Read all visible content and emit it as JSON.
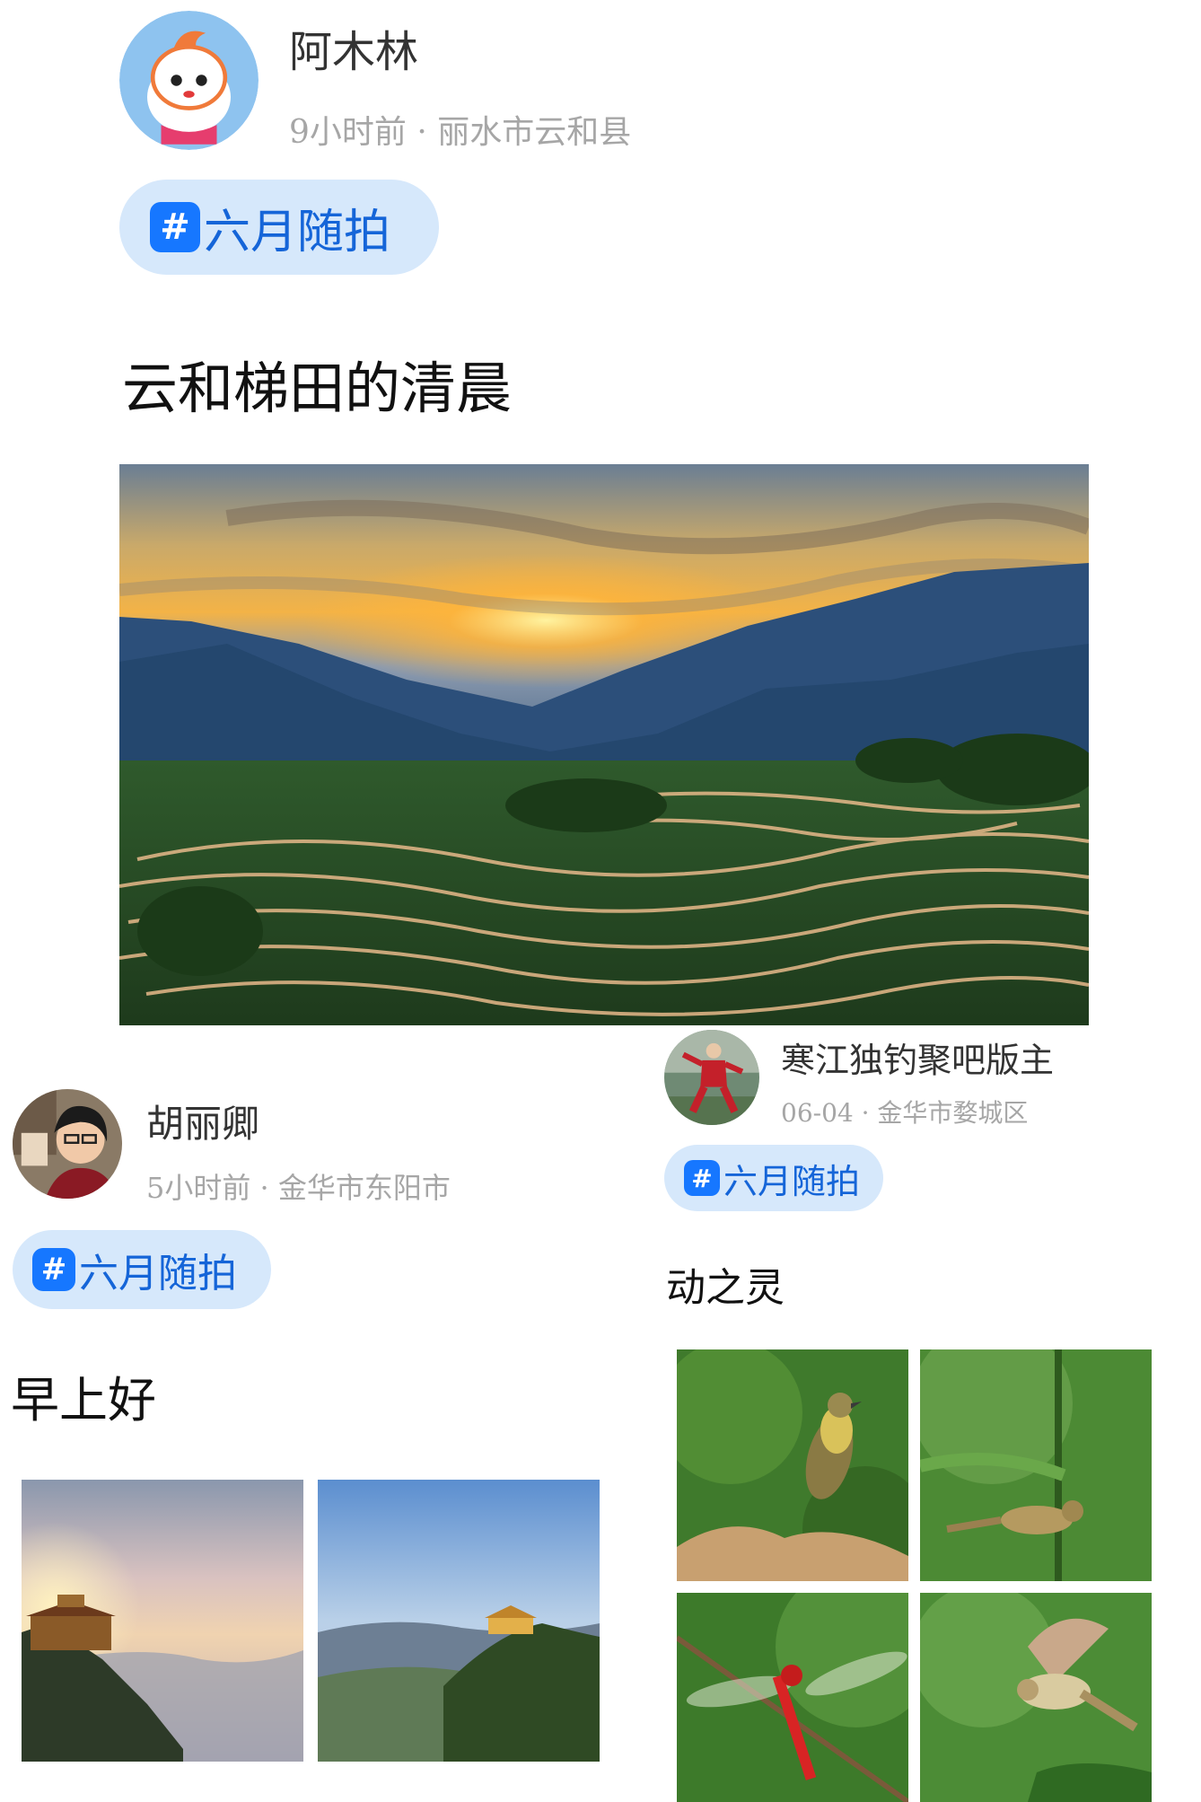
{
  "posts": [
    {
      "author": "阿木林",
      "meta": "9小时前 · 丽水市云和县",
      "tag": "六月随拍",
      "title": "云和梯田的清晨"
    },
    {
      "author": "胡丽卿",
      "meta": "5小时前 · 金华市东阳市",
      "tag": "六月随拍",
      "title": "早上好"
    },
    {
      "author": "寒江独钓聚吧版主",
      "meta": "06-04 · 金华市婺城区",
      "tag": "六月随拍",
      "title": "动之灵"
    }
  ],
  "tag_hash": "#",
  "colors": {
    "tag_bg": "#d6e8fb",
    "tag_text": "#1565d8",
    "hash_bg": "#1677ff",
    "meta_text": "#a6a6a6"
  }
}
